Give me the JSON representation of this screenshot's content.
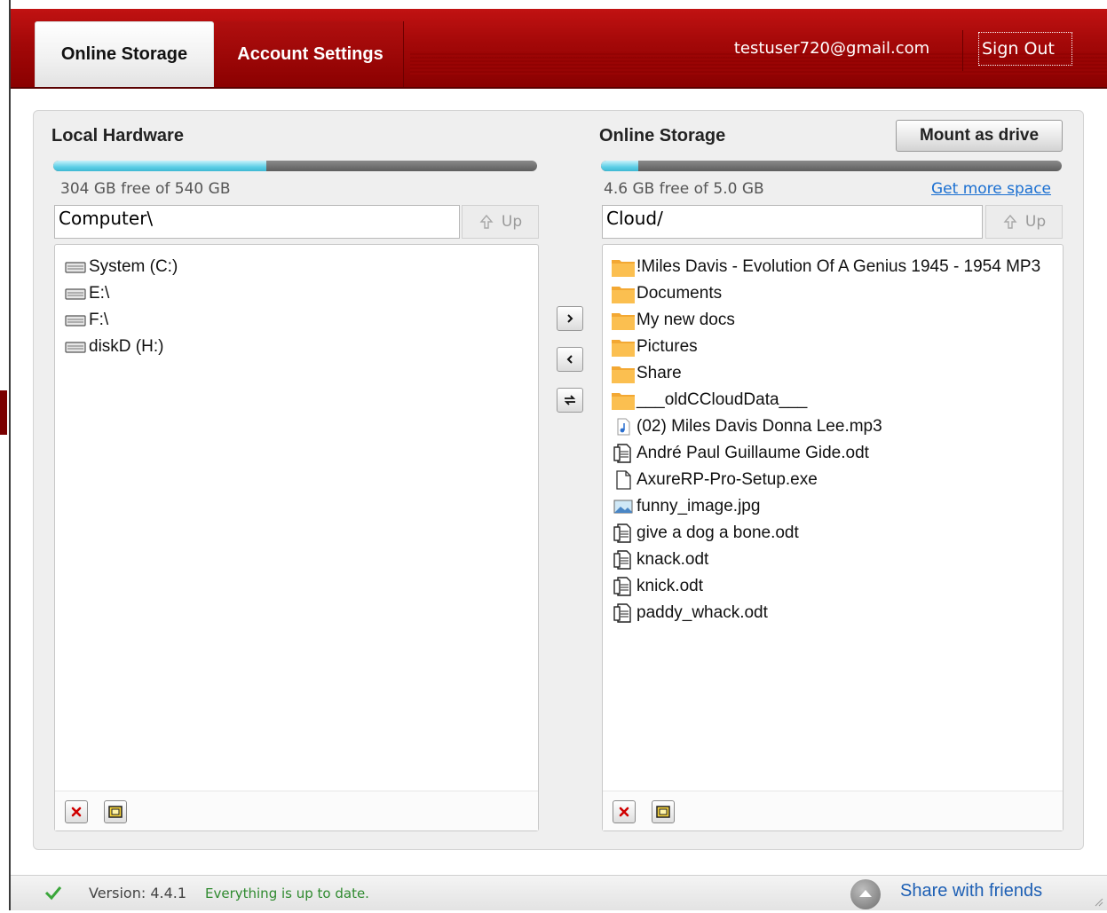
{
  "tabs": [
    {
      "label": "Online Storage",
      "active": true
    },
    {
      "label": "Account Settings",
      "active": false
    }
  ],
  "header": {
    "user_email": "testuser720@gmail.com",
    "sign_out_label": "Sign Out"
  },
  "local": {
    "title": "Local Hardware",
    "free_text": "304 GB free of 540 GB",
    "used_fraction": 0.44,
    "path_value": "Computer\\",
    "up_label": "Up",
    "items": [
      {
        "label": "System (C:)",
        "icon": "drive-icon"
      },
      {
        "label": "E:\\",
        "icon": "drive-icon"
      },
      {
        "label": "F:\\",
        "icon": "drive-icon"
      },
      {
        "label": "diskD (H:)",
        "icon": "drive-icon"
      }
    ]
  },
  "online": {
    "title": "Online Storage",
    "mount_label": "Mount as drive",
    "free_text": "4.6 GB free of 5.0 GB",
    "used_fraction": 0.08,
    "get_more_label": "Get more space",
    "path_value": "Cloud/",
    "up_label": "Up",
    "items": [
      {
        "label": "!Miles Davis - Evolution Of A Genius 1945 - 1954 MP3",
        "icon": "folder-icon"
      },
      {
        "label": "Documents",
        "icon": "folder-icon"
      },
      {
        "label": "My new docs",
        "icon": "folder-icon"
      },
      {
        "label": "Pictures",
        "icon": "folder-icon"
      },
      {
        "label": "Share",
        "icon": "folder-icon"
      },
      {
        "label": "___oldCCloudData___",
        "icon": "folder-icon"
      },
      {
        "label": "(02) Miles Davis Donna Lee.mp3",
        "icon": "audio-file-icon"
      },
      {
        "label": "André Paul Guillaume Gide.odt",
        "icon": "document-file-icon"
      },
      {
        "label": "AxureRP-Pro-Setup.exe",
        "icon": "blank-file-icon"
      },
      {
        "label": "funny_image.jpg",
        "icon": "image-file-icon"
      },
      {
        "label": "give a dog a bone.odt",
        "icon": "document-file-icon"
      },
      {
        "label": "knack.odt",
        "icon": "document-file-icon"
      },
      {
        "label": "knick.odt",
        "icon": "document-file-icon"
      },
      {
        "label": "paddy_whack.odt",
        "icon": "document-file-icon"
      }
    ]
  },
  "status": {
    "version": "Version: 4.4.1",
    "message": "Everything is up to date.",
    "share_label": "Share with friends"
  },
  "colors": {
    "header_red": "#a30808",
    "bar_fill": "#5ccfe6",
    "link_blue": "#1a6fd1",
    "ok_green": "#2f8a2f"
  }
}
